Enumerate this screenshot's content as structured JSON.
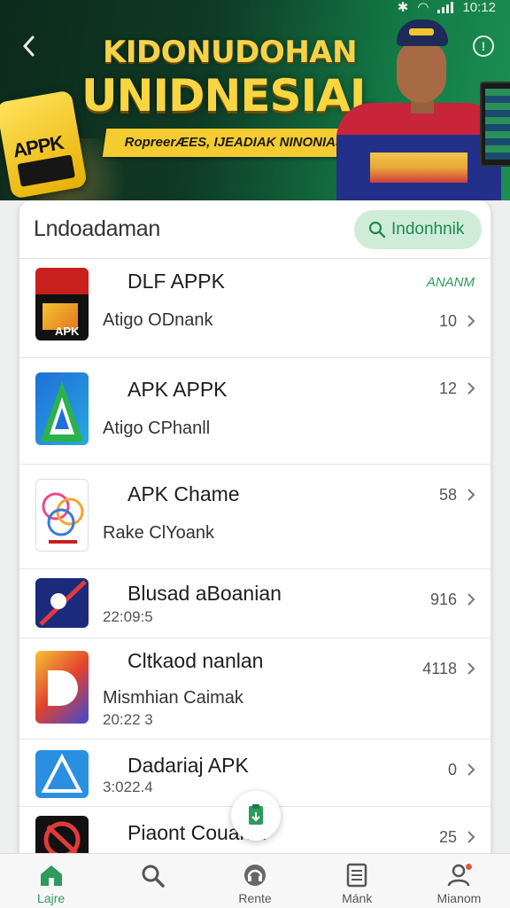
{
  "status_bar": {
    "time": "10:12"
  },
  "banner": {
    "title_line1": "KIDONUDOHAN",
    "title_line2": "UNIDNESIAL",
    "ribbon": "RopreerÆES, IJEADIAK NINONIA3",
    "card_line1": "APPK",
    "colors": {
      "bg": "#137a46",
      "title": "#f8d641"
    }
  },
  "header": {
    "title": "Lndoadaman",
    "search_label": "Indonhnik"
  },
  "list": [
    {
      "name": "DLF APPK",
      "sub": "Atigo ODnank",
      "count": "10",
      "tag": "ANANM",
      "icon": "apk-dark-icon"
    },
    {
      "name": "APK APPK",
      "sub": "Atigo CPhanll",
      "count": "12",
      "icon": "apk-blue-green-icon"
    },
    {
      "name": "APK Chame",
      "sub": "Rake ClYoank",
      "count": "58",
      "icon": "apk-colorful-icon"
    },
    {
      "name": "Blusad aBoanian",
      "date": "22:09:5",
      "count": "916",
      "icon": "apk-navy-icon"
    },
    {
      "name": "Cltkaod nanlan",
      "sub": "Mismhian Caimak",
      "date": "20:22 3",
      "count": "4118",
      "icon": "apk-rainbow-icon"
    },
    {
      "name": "Dadariaj APK",
      "date": "3:022.4",
      "count": "0",
      "icon": "apk-blue-icon"
    },
    {
      "name": "Piaont Couandl",
      "count": "25",
      "icon": "apk-red-icon"
    }
  ],
  "nav": [
    {
      "label": "Lajre",
      "icon": "home-icon",
      "active": true
    },
    {
      "label": "",
      "icon": "search-icon"
    },
    {
      "label": "Rente",
      "icon": "headset-icon"
    },
    {
      "label": "Mánk",
      "icon": "document-icon"
    },
    {
      "label": "Mianom",
      "icon": "profile-icon"
    }
  ],
  "accent": "#2e9a5e"
}
